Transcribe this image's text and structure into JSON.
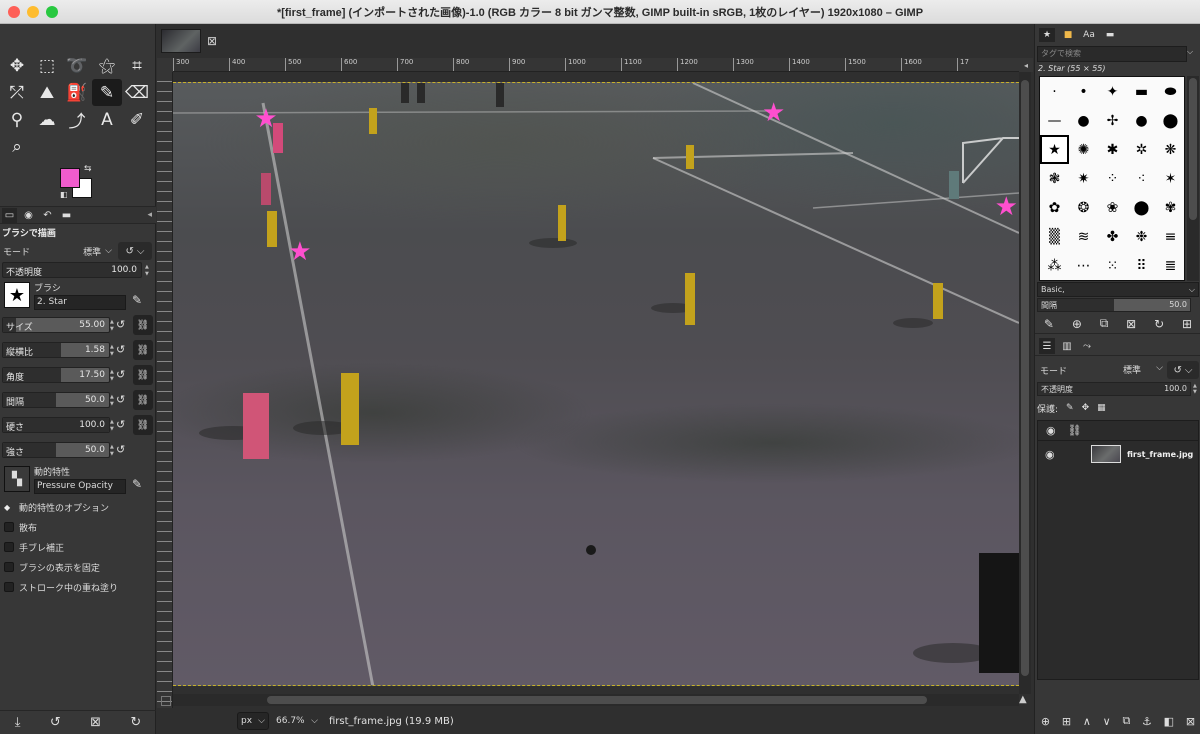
{
  "window": {
    "title": "*[first_frame] (インポートされた画像)-1.0 (RGB カラー 8 bit ガンマ整数, GIMP built-in sRGB, 1枚のレイヤー) 1920x1080 – GIMP",
    "traffic_colors": [
      "#fe5f57",
      "#febc2e",
      "#28c840"
    ]
  },
  "toolbox": {
    "tools": [
      {
        "name": "move-tool",
        "glyph": "✥"
      },
      {
        "name": "rect-select-tool",
        "glyph": "⬚"
      },
      {
        "name": "free-select-tool",
        "glyph": "➰"
      },
      {
        "name": "fuzzy-select-tool",
        "glyph": "⚝"
      },
      {
        "name": "crop-tool",
        "glyph": "⌗"
      },
      {
        "name": "unified-transform-tool",
        "glyph": "⤱"
      },
      {
        "name": "warp-tool",
        "glyph": "⛰"
      },
      {
        "name": "bucket-fill-tool",
        "glyph": "⛽"
      },
      {
        "name": "paintbrush-tool",
        "glyph": "✎"
      },
      {
        "name": "eraser-tool",
        "glyph": "⌫"
      },
      {
        "name": "clone-tool",
        "glyph": "⚲"
      },
      {
        "name": "smudge-tool",
        "glyph": "☁"
      },
      {
        "name": "paths-tool",
        "glyph": "⤴"
      },
      {
        "name": "text-tool",
        "glyph": "A"
      },
      {
        "name": "color-picker-tool",
        "glyph": "✐"
      },
      {
        "name": "zoom-tool",
        "glyph": "⌕"
      }
    ],
    "fg_color": "#f05ccd",
    "bg_color": "#ffffff"
  },
  "tool_options": {
    "title": "ブラシで描画",
    "mode_label": "モード",
    "mode_value": "標準",
    "opacity": {
      "label": "不透明度",
      "value": "100.0"
    },
    "brush_label": "ブラシ",
    "brush_name": "2. Star",
    "sliders": [
      {
        "label": "サイズ",
        "value": "55.00",
        "fraction": 0.12
      },
      {
        "label": "縦横比",
        "value": "1.58",
        "fraction": 0.55
      },
      {
        "label": "角度",
        "value": "17.50",
        "fraction": 0.55
      },
      {
        "label": "間隔",
        "value": "50.0",
        "fraction": 0.5
      },
      {
        "label": "硬さ",
        "value": "100.0",
        "fraction": 1.0
      },
      {
        "label": "強さ",
        "value": "50.0",
        "fraction": 0.5
      }
    ],
    "dynamics_label": "動的特性",
    "dynamics_name": "Pressure Opacity",
    "dynamics_options": "動的特性のオプション",
    "checkboxes": [
      "散布",
      "手ブレ補正",
      "ブラシの表示を固定",
      "ストローク中の重ね塗り"
    ]
  },
  "image": {
    "ruler_labels": [
      "300",
      "400",
      "500",
      "600",
      "700",
      "800",
      "900",
      "1000",
      "1100",
      "1200",
      "1300",
      "1400",
      "1500",
      "1600",
      "17"
    ],
    "unit": "px",
    "zoom": "66.7%",
    "status": "first_frame.jpg (19.9 MB)"
  },
  "brushes": {
    "search_placeholder": "タグで検索",
    "selected_title": "2. Star (55 × 55)",
    "preset": "Basic,",
    "spacing": {
      "label": "間隔",
      "value": "50.0",
      "fraction": 0.5
    }
  },
  "layers": {
    "mode_label": "モード",
    "mode_value": "標準",
    "opacity": {
      "label": "不透明度",
      "value": "100.0"
    },
    "lock_label": "保護:",
    "items": [
      {
        "name": "first_frame.jpg"
      }
    ]
  },
  "canvas": {
    "star_color": "#ff4fcf",
    "stars": [
      [
        0.11,
        0.06
      ],
      [
        0.71,
        0.05
      ],
      [
        0.15,
        0.28
      ],
      [
        0.985,
        0.205
      ]
    ]
  }
}
